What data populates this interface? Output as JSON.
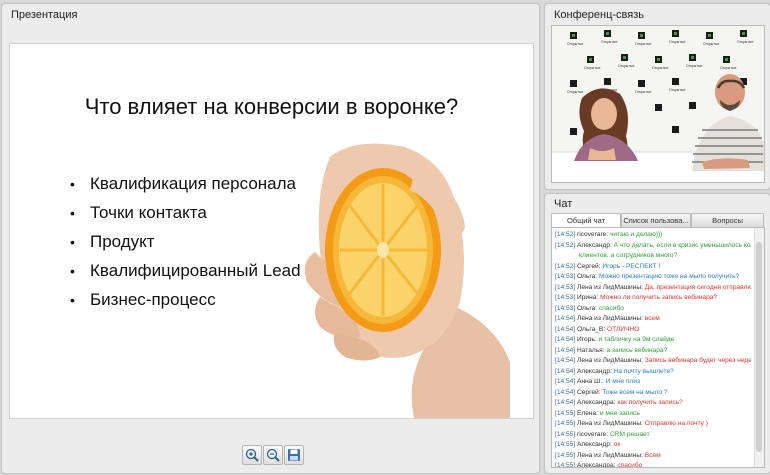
{
  "presentation": {
    "panel_title": "Презентация",
    "slide_title": "Что влияет на конверсии в воронке?",
    "bullets": [
      "Квалификация персонала",
      "Точки контакта",
      "Продукт",
      "Квалифицированный Lead",
      "Бизнес-процесс"
    ],
    "toolbar_icons": [
      "zoom-in-icon",
      "zoom-out-icon",
      "save-icon"
    ]
  },
  "video": {
    "panel_title": "Конференц-связь",
    "backdrop_text": "Открытые вебинары"
  },
  "chat": {
    "panel_title": "Чат",
    "tabs": [
      "Общий чат",
      "Список пользова...",
      "Вопросы"
    ],
    "messages": [
      {
        "time": "[14:52]",
        "user": "ricoverare:",
        "text": "читаю и делаю)))",
        "color": "#2e9e3a"
      },
      {
        "time": "[14:52]",
        "user": "Александр:",
        "text": "А что делать, если в кризис уменьшилось кол-во",
        "color": "#2e9e3a"
      },
      {
        "time": "",
        "user": "",
        "text": "клиентов, а сотрудников много?",
        "color": "#2e9e3a"
      },
      {
        "time": "[14:52]",
        "user": "Сергей:",
        "text": "Игорь - РЕСПЕКТ !",
        "color": "#2a7fc1"
      },
      {
        "time": "[14:53]",
        "user": "Ольга:",
        "text": "Можно презентацию тоже на мыло получить?",
        "color": "#2a7fc1"
      },
      {
        "time": "[14:53]",
        "user": "Лена из ЛидМашины:",
        "text": "Да, презентация сегодня отправлю",
        "color": "#e0332e"
      },
      {
        "time": "[14:53]",
        "user": "Ирина:",
        "text": "Можно ли получить запись вебинара?",
        "color": "#e0332e"
      },
      {
        "time": "[14:53]",
        "user": "Ольга:",
        "text": "спасибо",
        "color": "#2e9e3a"
      },
      {
        "time": "[14:54]",
        "user": "Лена из ЛидМашины:",
        "text": "всем",
        "color": "#e0332e"
      },
      {
        "time": "[14:54]",
        "user": "Ольга_В:",
        "text": "ОТЛИЧНО",
        "color": "#e0332e"
      },
      {
        "time": "[14:54]",
        "user": "Игорь:",
        "text": "и табличку на 9м слайде",
        "color": "#2e9e3a"
      },
      {
        "time": "[14:54]",
        "user": "Наталья:",
        "text": "а запись вебинара?",
        "color": "#2e9e3a"
      },
      {
        "time": "[14:54]",
        "user": "Лена из ЛидМашины:",
        "text": "Запись вебинара будет через неделю",
        "color": "#e0332e"
      },
      {
        "time": "[14:54]",
        "user": "Александр:",
        "text": "На почту вышлете?",
        "color": "#2a7fc1"
      },
      {
        "time": "[14:54]",
        "user": "Анна Ш.:",
        "text": "И мне плиз",
        "color": "#2a7fc1"
      },
      {
        "time": "[14:54]",
        "user": "Сергей:",
        "text": "Тоже всем на мыло ?",
        "color": "#2a7fc1"
      },
      {
        "time": "[14:54]",
        "user": "Александра:",
        "text": "как получить запись?",
        "color": "#e0332e"
      },
      {
        "time": "[14:55]",
        "user": "Елена:",
        "text": "и мне запись",
        "color": "#2e9e3a"
      },
      {
        "time": "[14:55]",
        "user": "Лена из ЛидМашины:",
        "text": "Отправлю на почту )",
        "color": "#e0332e"
      },
      {
        "time": "[14:55]",
        "user": "ricoverare:",
        "text": "CRM решает",
        "color": "#2e9e3a"
      },
      {
        "time": "[14:55]",
        "user": "Александр:",
        "text": "ок",
        "color": "#e0332e"
      },
      {
        "time": "[14:55]",
        "user": "Лена из ЛидМашины:",
        "text": "Всем",
        "color": "#e0332e"
      },
      {
        "time": "[14:55]",
        "user": "Александра:",
        "text": "спасибо",
        "color": "#e0332e"
      }
    ]
  }
}
